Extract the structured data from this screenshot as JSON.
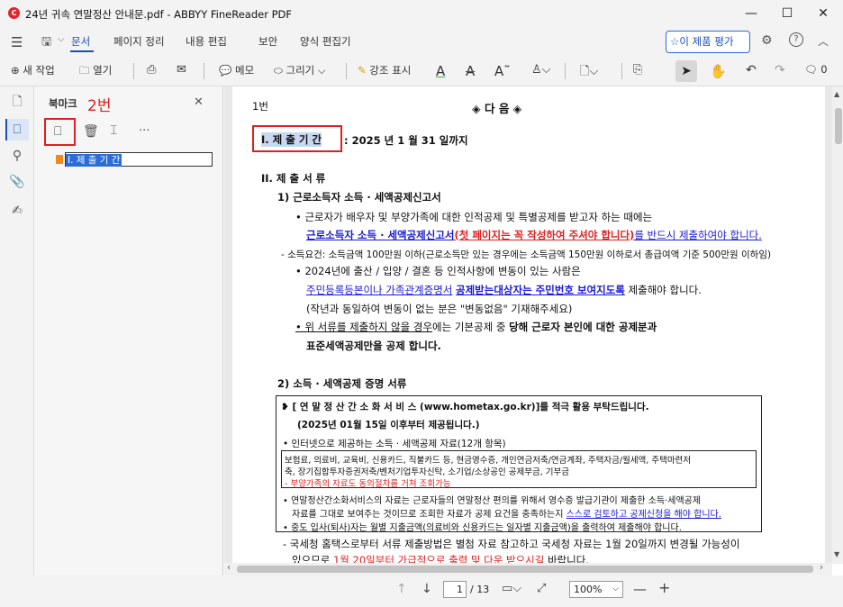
{
  "window": {
    "title": "24년 귀속 연말정산 안내문.pdf - ABBYY FineReader PDF",
    "logo_text": "C",
    "minimize": "—",
    "maximize": "☐",
    "close": "✕"
  },
  "menu": {
    "items": [
      "문서",
      "페이지 정리",
      "내용 편집",
      "보안",
      "양식 편집기"
    ],
    "active": "문서",
    "rate_button": "이 제품 평가"
  },
  "toolbar": {
    "new_task": "새 작업",
    "open": "열기",
    "memo": "메모",
    "draw": "그리기",
    "highlight": "강조 표시",
    "comment_count": "0"
  },
  "panel": {
    "title": "북마크",
    "annotation_2": "2번",
    "bookmark_item": "I. 제 출 기 간"
  },
  "document": {
    "annotation_1": "1번",
    "heading": "◈  다        음  ◈",
    "period_label": "I. 제 출 기 간",
    "period_value": ":  2025 년   1 월   31 일까지",
    "section2": "II. 제 출 서 류",
    "sub1": "1)  근로소득자 소득 · 세액공제신고서",
    "line1": "• 근로자가 배우자 및 부양가족에 대한 인적공제 및 특별공제를 받고자 하는 때에는",
    "line2a": "근로소득자 소득 · 세액공제신고서",
    "line2b": "(첫 페이지는 꼭 작성하여 주셔야 합니다)",
    "line2c": "를 반드시 제출하여야 합니다.",
    "line3": "- 소득요건: 소득금액 100만원 이하(근로소득만 있는 경우에는 소득금액 150만원 이하로서 총급여액 기준 500만원 이하임)",
    "line4": "• 2024년에 출산 / 입양 / 결혼 등 인적사항에 변동이 있는 사람은",
    "line5a": "주민등록등본이나 가족관계증명서",
    "line5b": "공제받는대상자는 주민번호 보여지도록",
    "line5c": "제출해야 합니다.",
    "line6": "(작년과 동일하여 변동이 없는 분은 \"변동없음\" 기재해주세요)",
    "line7a": "• 위 서류를 제출하지 않을 경우",
    "line7b": "에는 기본공제 중 ",
    "line7c": "당해 근로자 본인에 대한 공제분과",
    "line8": "표준세액공제만을 공제 합니다.",
    "sub2": "2) 소득 · 세액공제 증명 서류",
    "box_line1": "❥ [ 연 말 정 산 간 소 화 서 비 스  (www.hometax.go.kr)]를  적극 활용 부탁드립니다.",
    "box_line2": "(2025년 01월 15일 이후부터 제공됩니다.)",
    "box_line3": "• 인터넷으로 제공하는 소득 · 세액공제 자료(12개 항목)",
    "inner_line1": "보험료, 의료비, 교육비, 신용카드, 직불카드 등, 현금영수증, 개인연금저축/연금계좌, 주택자금/월세액, 주택마련저",
    "inner_line2": "축, 장기집합투자증권저축/벤처기업투자신탁, 소기업/소상공인 공제부금, 기부금",
    "inner_line3": "- 부양가족의 자료도 동의절차를 거쳐 조회가능",
    "box_line4": "• 연말정산간소화서비스의 자료는 근로자들의 연말정산 편의를 위해서 영수증 발급기관이 제출한 소득·세액공제",
    "box_line5a": "자료를 그대로 보여주는 것이므로 조회한 자료가 공제 요건을 충족하는지 ",
    "box_line5b": "스스로 검토하고 공제신청을 해야 합니다.",
    "box_line6": "• 중도 입사(퇴사)자는 월별 지출금액(의료비와 신용카드는 일자별 지출금액)을 출력하여 제출해야 합니다.",
    "line9": "- 국세청 홈택스로부터 서류 제출방법은 별첨 자료 참고하고 국세청 자료는 1월 20일까지 변경될 가능성이",
    "line10a": "있으므로 ",
    "line10b": "1월 20일부터 가급적으로 출력 및 다운 받으시길",
    "line10c": " 바랍니다."
  },
  "status": {
    "page_current": "1",
    "page_total": "/ 13",
    "zoom": "100%"
  },
  "colors": {
    "annotation_red": "#e02020",
    "link_blue": "#1a1ad6",
    "accent": "#2b6cd8"
  }
}
